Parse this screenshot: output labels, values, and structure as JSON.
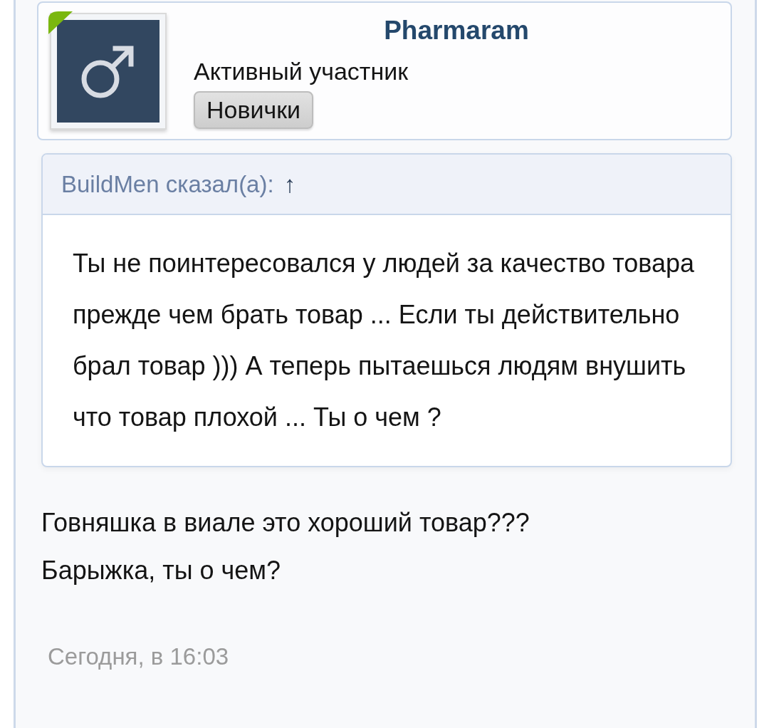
{
  "user_card": {
    "username": "Pharmaram",
    "online": true,
    "user_title": "Активный участник",
    "banner": "Новички"
  },
  "quote": {
    "attribution": "BuildMen сказал(а):",
    "jump_arrow": "↑",
    "text": "Ты не поинтересовался у людей за качество товара прежде чем брать товар ... Если ты действительно брал товар ))) А теперь пытаешься людям внушить что товар плохой ... Ты о чем ?"
  },
  "message": [
    "Говняшка в виале это хороший товар???",
    "Барыжка, ты о чем?"
  ],
  "date": "Сегодня, в 16:03"
}
